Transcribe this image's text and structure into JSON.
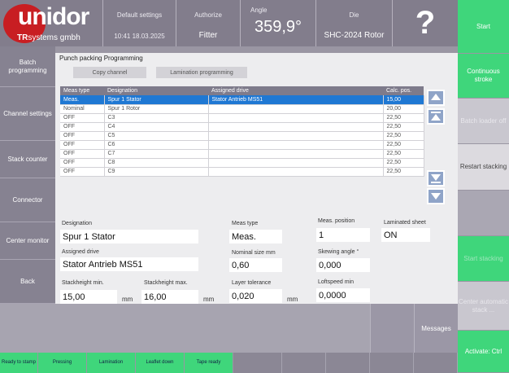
{
  "header": {
    "brand": "unidor",
    "brand_sub_1": "TR",
    "brand_sub_2": "systems gmbh",
    "settings_label": "Default settings",
    "datetime": "10:41 18.03.2025",
    "authorize_label": "Authorize",
    "authorize_value": "Fitter",
    "angle_label": "Angle",
    "angle_value": "359,9°",
    "die_label": "Die",
    "die_value": "SHC-2024 Rotor",
    "help_symbol": "?"
  },
  "left_nav": [
    {
      "label": "Batch programming"
    },
    {
      "label": "Channel settings"
    },
    {
      "label": "Stack counter"
    },
    {
      "label": "Connector"
    },
    {
      "label": "Center monitor"
    },
    {
      "label": "Back"
    }
  ],
  "right_nav": [
    {
      "label": "Start"
    },
    {
      "label": "Continuous stroke"
    },
    {
      "label": "Batch loader off"
    },
    {
      "label": "Restart stacking"
    },
    {
      "label": ""
    },
    {
      "label": "Start stacking"
    },
    {
      "label": "Center automatic stack ..."
    },
    {
      "label": "Activate: Ctrl"
    }
  ],
  "panel": {
    "title": "Punch packing Programming",
    "tab_copy": "Copy channel",
    "tab_lamination": "Lamination programming",
    "columns": [
      "Meas type",
      "Designation",
      "Assigned drive",
      "Calc. pos."
    ],
    "rows": [
      {
        "meas": "Meas.",
        "designation": "Spur 1 Stator",
        "drive": "Stator Antrieb MS51",
        "calc": "15,00",
        "selected": true
      },
      {
        "meas": "Nominal",
        "designation": "Spur 1 Rotor",
        "drive": "",
        "calc": "20,00",
        "selected": false
      },
      {
        "meas": "OFF",
        "designation": "C3",
        "drive": "",
        "calc": "22,50",
        "selected": false
      },
      {
        "meas": "OFF",
        "designation": "C4",
        "drive": "",
        "calc": "22,50",
        "selected": false
      },
      {
        "meas": "OFF",
        "designation": "C5",
        "drive": "",
        "calc": "22,50",
        "selected": false
      },
      {
        "meas": "OFF",
        "designation": "C6",
        "drive": "",
        "calc": "22,50",
        "selected": false
      },
      {
        "meas": "OFF",
        "designation": "C7",
        "drive": "",
        "calc": "22,50",
        "selected": false
      },
      {
        "meas": "OFF",
        "designation": "C8",
        "drive": "",
        "calc": "22,50",
        "selected": false
      },
      {
        "meas": "OFF",
        "designation": "C9",
        "drive": "",
        "calc": "22,50",
        "selected": false
      }
    ],
    "fields": {
      "designation_label": "Designation",
      "designation_value": "Spur 1 Stator",
      "assigned_drive_label": "Assigned drive",
      "assigned_drive_value": "Stator Antrieb MS51",
      "stack_min_label": "Stackheight min.",
      "stack_min_value": "15,00",
      "stack_min_unit": "mm",
      "stack_max_label": "Stackheight max.",
      "stack_max_value": "16,00",
      "stack_max_unit": "mm",
      "meas_type_label": "Meas type",
      "meas_type_value": "Meas.",
      "nominal_size_label": "Nominal size mm",
      "nominal_size_value": "0,60",
      "layer_tol_label": "Layer tolerance",
      "layer_tol_value": "0,020",
      "layer_tol_unit": "mm",
      "meas_pos_label": "Meas. position",
      "meas_pos_value": "1",
      "skew_label": "Skewing angle °",
      "skew_value": "0,000",
      "loftspeed_label": "Loftspeed min",
      "loftspeed_value": "0,0000",
      "laminated_label": "Laminated sheet",
      "laminated_value": "ON"
    }
  },
  "bottom": {
    "messages_label": "Messages"
  },
  "footer": [
    {
      "label": "Ready to stamp"
    },
    {
      "label": "Pressing"
    },
    {
      "label": "Lamination"
    },
    {
      "label": "Leaflet down"
    },
    {
      "label": "Tape ready"
    }
  ]
}
